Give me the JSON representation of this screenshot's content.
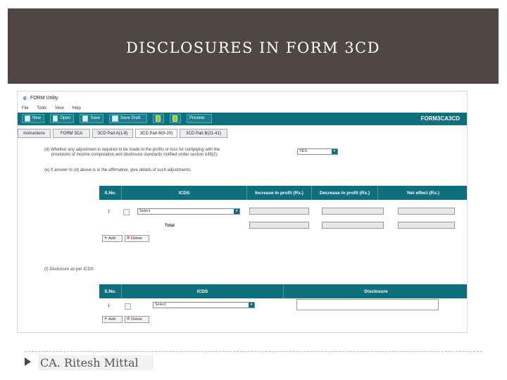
{
  "slide": {
    "title": "DISCLOSURES IN FORM 3CD",
    "footer": "CA. Ritesh Mittal"
  },
  "app": {
    "icon": "e",
    "title": "FORM Utility",
    "menu": [
      "File",
      "Tools",
      "View",
      "Help"
    ],
    "toolbar": {
      "new": "New",
      "open": "Open",
      "save": "Save",
      "save_draft": "Save Draft",
      "preview": "Preview",
      "form_name": "FORM3CA3CD"
    },
    "tabs": [
      "Instructions",
      "FORM 3CA",
      "3CD Part A(1-8)",
      "3CD Part B(9-20)",
      "3CD Part B(21-41)"
    ],
    "active_tab": 3
  },
  "section_d": {
    "question_line1": "(d)  Whether any adjustment is required to be made to the profits or loss for complying with the",
    "question_line2": "provisions of income computation and disclosure standards notified under section 145(2).",
    "answer": "YES"
  },
  "section_e": {
    "question": "(e)  If answer to (d) above is in the affirmative, give details of such adjustments:",
    "headers": {
      "sno": "S.No.",
      "icds": "ICDS",
      "increase": "Increase in profit (Rs.)",
      "decrease": "Decrease in profit (Rs.)",
      "net": "Net effect (Rs.)"
    },
    "row_sno": "1",
    "select_value": "Select",
    "total_label": "Total",
    "add_label": "Add",
    "delete_label": "Delete"
  },
  "section_f": {
    "question": "(f)  Disclosure as per ICDS:",
    "headers": {
      "sno": "S.No.",
      "icds": "ICDS",
      "disclosure": "Disclosure"
    },
    "row_sno": "1",
    "select_value": "Select",
    "add_label": "Add",
    "delete_label": "Delete"
  },
  "colors": {
    "slide_header": "#4f4745",
    "app_accent": "#0e6f7d"
  }
}
